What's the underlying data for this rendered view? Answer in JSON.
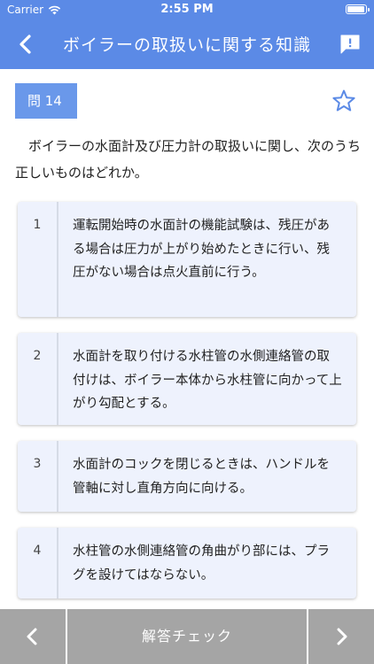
{
  "status": {
    "carrier": "Carrier",
    "time": "2:55 PM",
    "battery_level": 0.95
  },
  "nav": {
    "title": "ボイラーの取扱いに関する知識"
  },
  "question": {
    "number_label": "問 14",
    "text": "ボイラーの水面計及び圧力計の取扱いに関し、次のうち正しいものはどれか。"
  },
  "choices": [
    {
      "num": "1",
      "text": "運転開始時の水面計の機能試験は、残圧がある場合は圧力が上がり始めたときに行い、残圧がない場合は点火直前に行う。"
    },
    {
      "num": "2",
      "text": "水面計を取り付ける水柱管の水側連絡管の取付けは、ボイラー本体から水柱管に向かって上がり勾配とする。"
    },
    {
      "num": "3",
      "text": "水面計のコックを閉じるときは、ハンドルを管軸に対し直角方向に向ける。"
    },
    {
      "num": "4",
      "text": "水柱管の水側連絡管の角曲がり部には、プラグを設けてはならない。"
    }
  ],
  "bottom": {
    "check_label": "解答チェック"
  },
  "colors": {
    "primary": "#5b8ae6",
    "badge": "#6a98ea",
    "card": "#eef2fd",
    "bottom_bar": "#a5a5a5"
  }
}
